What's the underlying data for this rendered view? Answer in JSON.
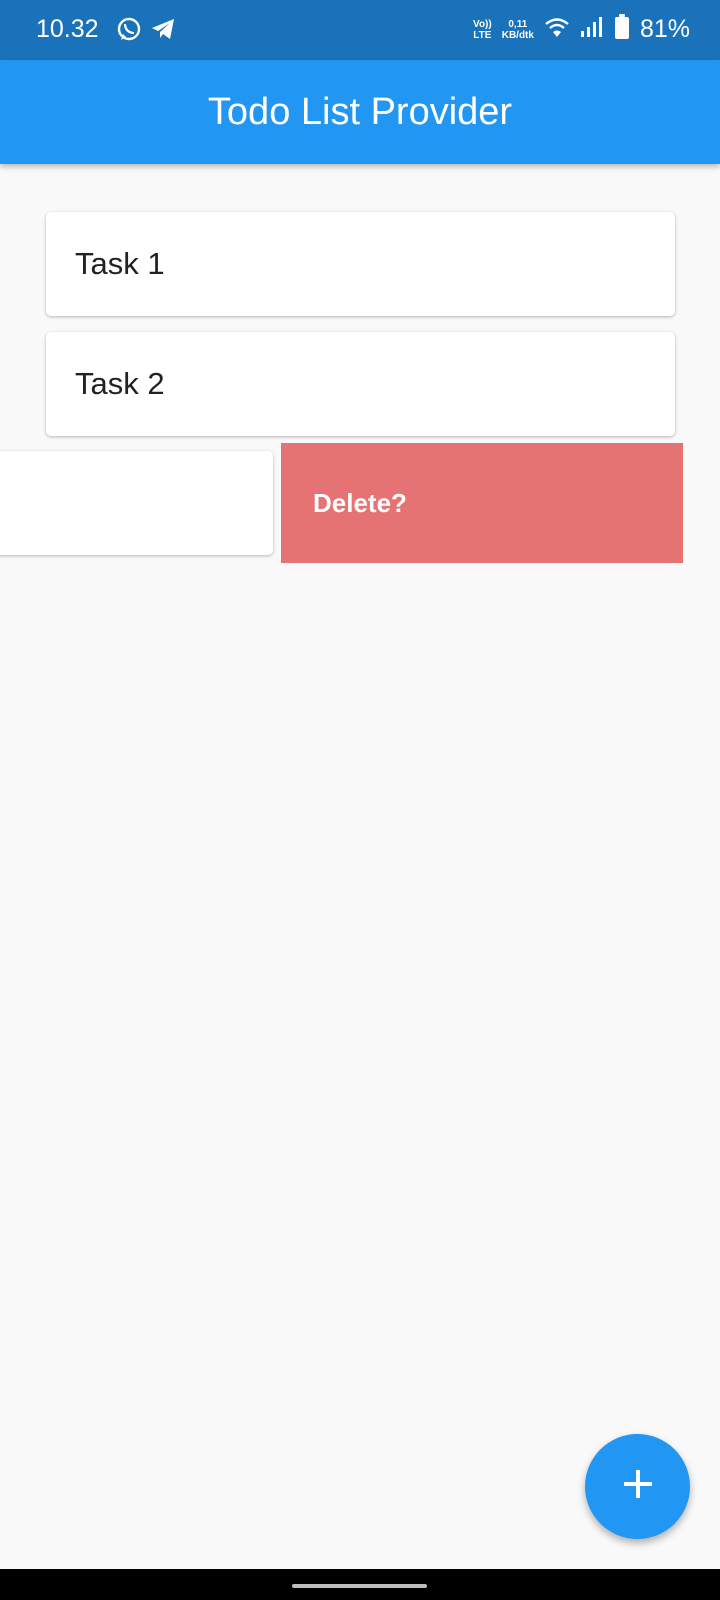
{
  "status_bar": {
    "time": "10.32",
    "volte_top": "Vo))",
    "volte_bottom": "LTE",
    "speed_value": "0,11",
    "speed_unit": "KB/dtk",
    "battery_percent": "81%",
    "icons": [
      "whatsapp-icon",
      "telegram-icon",
      "wifi-icon",
      "signal-icon",
      "battery-icon"
    ]
  },
  "app_bar": {
    "title": "Todo List Provider"
  },
  "tasks": [
    {
      "title": "Task 1"
    },
    {
      "title": "Task 2"
    }
  ],
  "dismiss_background": {
    "label": "Delete?"
  },
  "fab": {
    "icon": "add-icon"
  },
  "colors": {
    "status_bar": "#1a72ba",
    "app_bar": "#2196f3",
    "background": "#f9f9f9",
    "delete": "#e57373",
    "fab": "#2196f3"
  }
}
